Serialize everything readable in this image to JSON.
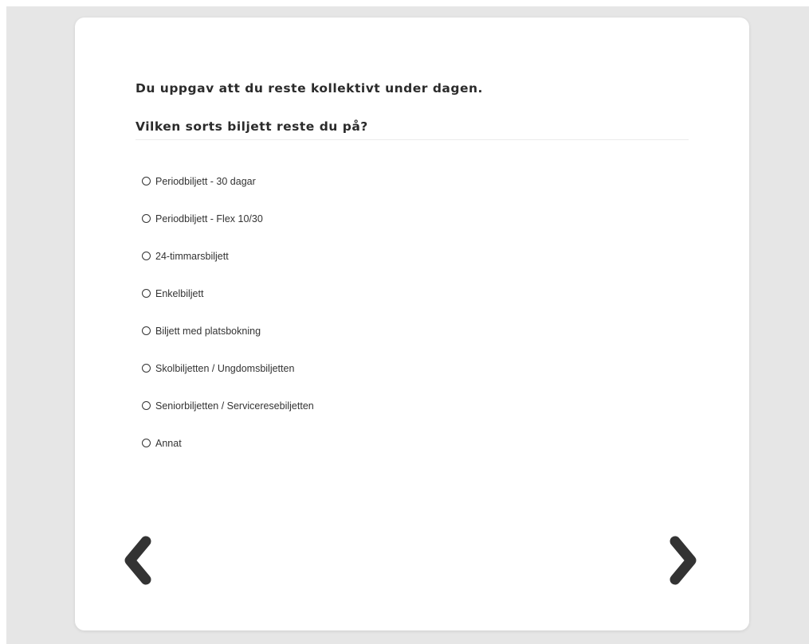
{
  "survey": {
    "intro": "Du uppgav att du reste kollektivt under dagen.",
    "question": "Vilken sorts biljett reste du på?",
    "options": [
      {
        "label": "Periodbiljett - 30 dagar"
      },
      {
        "label": "Periodbiljett - Flex 10/30"
      },
      {
        "label": "24-timmarsbiljett"
      },
      {
        "label": "Enkelbiljett"
      },
      {
        "label": "Biljett med platsbokning"
      },
      {
        "label": "Skolbiljetten / Ungdomsbiljetten"
      },
      {
        "label": "Seniorbiljetten / Serviceresebiljetten"
      },
      {
        "label": "Annat"
      }
    ]
  },
  "navigation": {
    "prev_icon": "chevron-left-icon",
    "next_icon": "chevron-right-icon"
  },
  "colors": {
    "page_background": "#e6e6e6",
    "card_background": "#ffffff",
    "text": "#2b2b2b",
    "arrow": "#333333"
  }
}
